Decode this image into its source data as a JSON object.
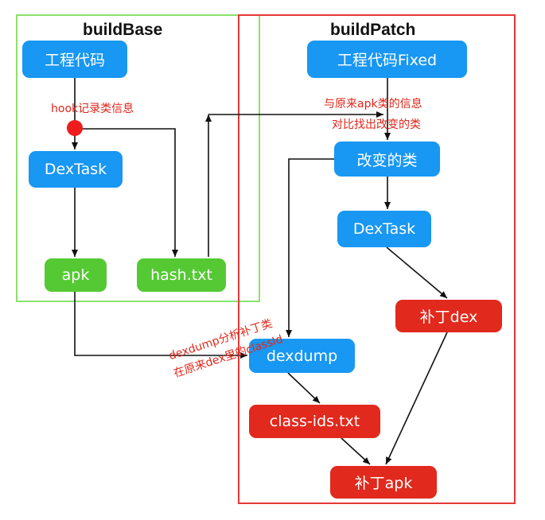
{
  "groups": {
    "build_base": {
      "title": "buildBase"
    },
    "build_patch": {
      "title": "buildPatch"
    }
  },
  "nodes": {
    "base_source": "工程代码",
    "base_dextask": "DexTask",
    "base_apk": "apk",
    "base_hash": "hash.txt",
    "patch_source": "工程代码Fixed",
    "changed_classes": "改变的类",
    "patch_dextask": "DexTask",
    "patch_dex": "补丁dex",
    "dexdump": "dexdump",
    "class_ids": "class-ids.txt",
    "patch_apk": "补丁apk"
  },
  "annotations": {
    "hook": "hook记录类信息",
    "compare_line1": "与原来apk类的信息",
    "compare_line2": "对比找出改变的类",
    "dexdump_line1": "dexdump分析补丁类",
    "dexdump_line2": "在原来dex里的classId"
  },
  "colors": {
    "base_frame": "#8be26b",
    "patch_frame": "#e53935",
    "blue_node": "#1897f3",
    "green_node": "#55c933",
    "red_node": "#e1291d",
    "annotation": "#e0261a",
    "hook_dot": "#ee1c1c"
  }
}
